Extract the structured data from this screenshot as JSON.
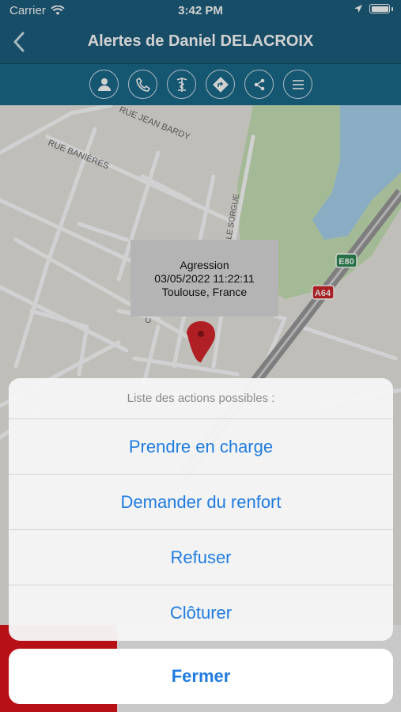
{
  "status_bar": {
    "carrier": "Carrier",
    "time": "3:42 PM"
  },
  "header": {
    "title": "Alertes de Daniel DELACROIX"
  },
  "toolbar": {
    "icons": [
      "person-icon",
      "phone-icon",
      "caduceus-icon",
      "directions-icon",
      "share-icon",
      "menu-icon"
    ]
  },
  "map": {
    "street_labels": [
      "RUE JEAN BARDY",
      "RUE BANIÈRES",
      "LE SORGUE",
      "C"
    ],
    "road_shields": {
      "e80": "E80",
      "a64": "A64"
    },
    "callout": {
      "type": "Agression",
      "datetime": "03/05/2022 11:22:11",
      "location": "Toulouse, France"
    }
  },
  "action_sheet": {
    "title": "Liste des actions possibles :",
    "actions": [
      "Prendre en charge",
      "Demander du renfort",
      "Refuser",
      "Clôturer"
    ],
    "cancel": "Fermer"
  },
  "colors": {
    "header": "#1e5f7e",
    "toolbar": "#1a6a8a",
    "action_blue": "#1f7ce0",
    "pin_red": "#d7262c"
  }
}
